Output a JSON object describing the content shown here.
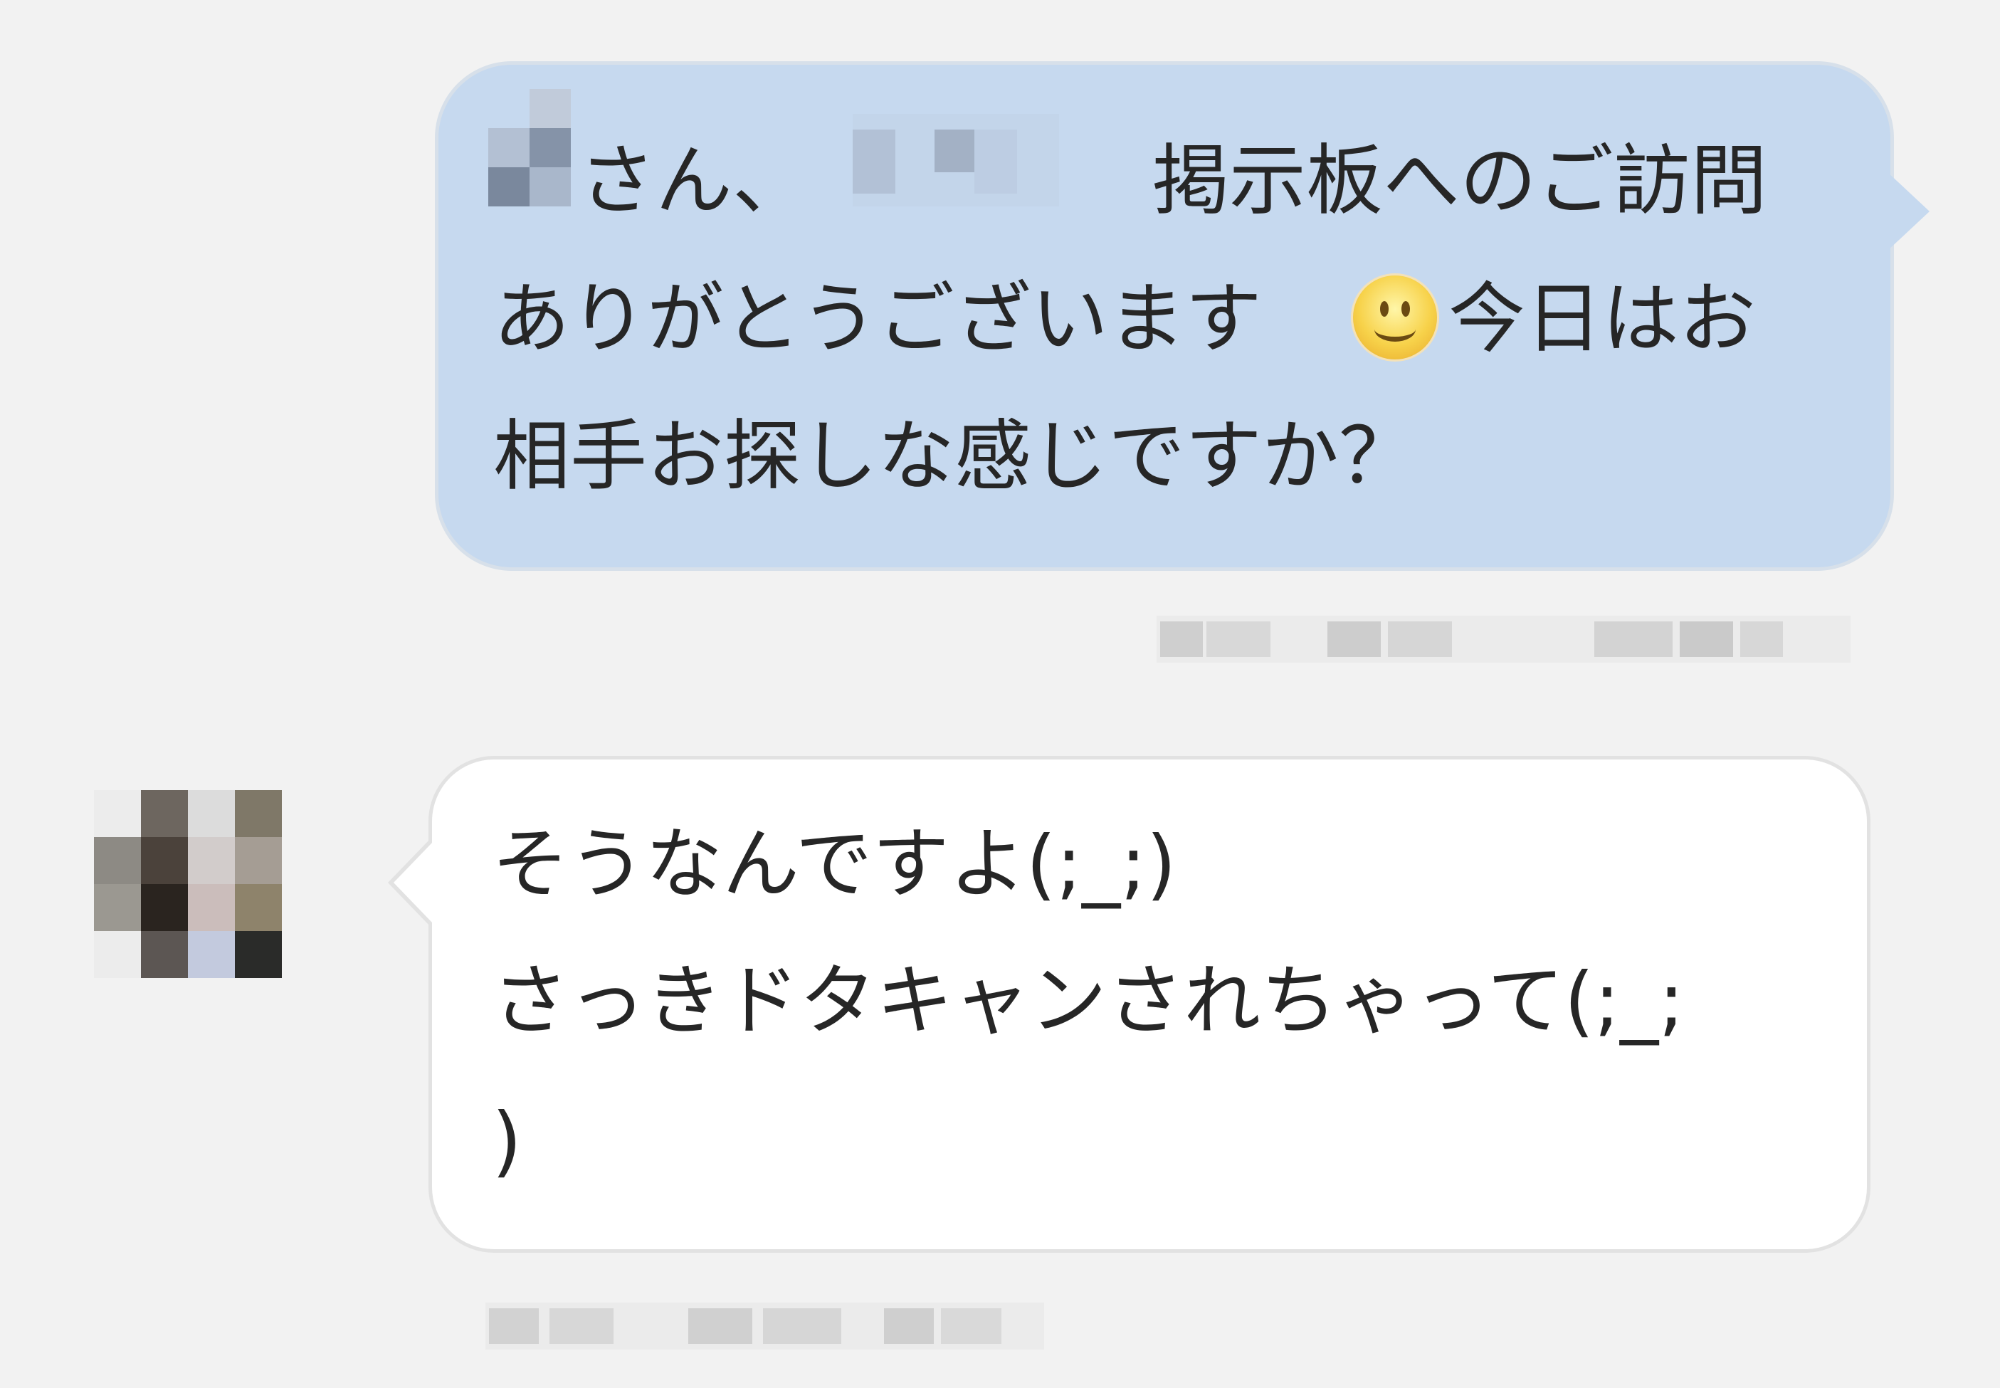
{
  "conversation": {
    "messages": [
      {
        "sender": "self",
        "name_suffix": "さん、",
        "line1_text": "掲示板へのご訪問",
        "line2_text": "ありがとうございます",
        "line2_after_emoji": "今日はお",
        "line3_text": "相手お探しな感じですか？",
        "emoji": "smiling-face-icon",
        "bubble_color": "#c6d9ef"
      },
      {
        "sender": "other",
        "line1_text": "そうなんですよ(;_;)",
        "line2_text": "さっきドタキャンされちゃって(;_;",
        "line3_text": ")",
        "bubble_color": "#ffffff"
      }
    ]
  }
}
